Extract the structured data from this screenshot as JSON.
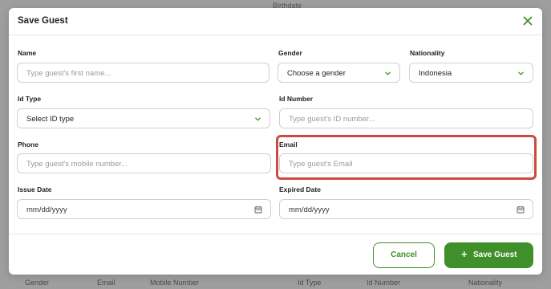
{
  "background": {
    "top_header": "Birthdate",
    "bottom_headers": [
      "Gender",
      "Email",
      "Mobile Number",
      "Id Type",
      "Id Number",
      "Nationality"
    ]
  },
  "modal": {
    "title": "Save Guest",
    "close_icon": "close-icon"
  },
  "form": {
    "name": {
      "label": "Name",
      "placeholder": "Type guest's first name..."
    },
    "gender": {
      "label": "Gender",
      "value": "Choose a gender"
    },
    "nationality": {
      "label": "Nationality",
      "value": "Indonesia"
    },
    "id_type": {
      "label": "Id Type",
      "value": "Select ID type"
    },
    "id_number": {
      "label": "Id Number",
      "placeholder": "Type guest's ID number..."
    },
    "phone": {
      "label": "Phone",
      "placeholder": "Type guest's mobile number..."
    },
    "email": {
      "label": "Email",
      "placeholder": "Type guest's Email"
    },
    "issue_date": {
      "label": "Issue Date",
      "value": "mm/dd/yyyy"
    },
    "expired_date": {
      "label": "Expired Date",
      "value": "mm/dd/yyyy"
    }
  },
  "actions": {
    "cancel_label": "Cancel",
    "save_label": "Save Guest",
    "save_icon": "plus-icon"
  },
  "colors": {
    "accent": "#3f8f2a",
    "highlight": "#cc4b3f"
  }
}
